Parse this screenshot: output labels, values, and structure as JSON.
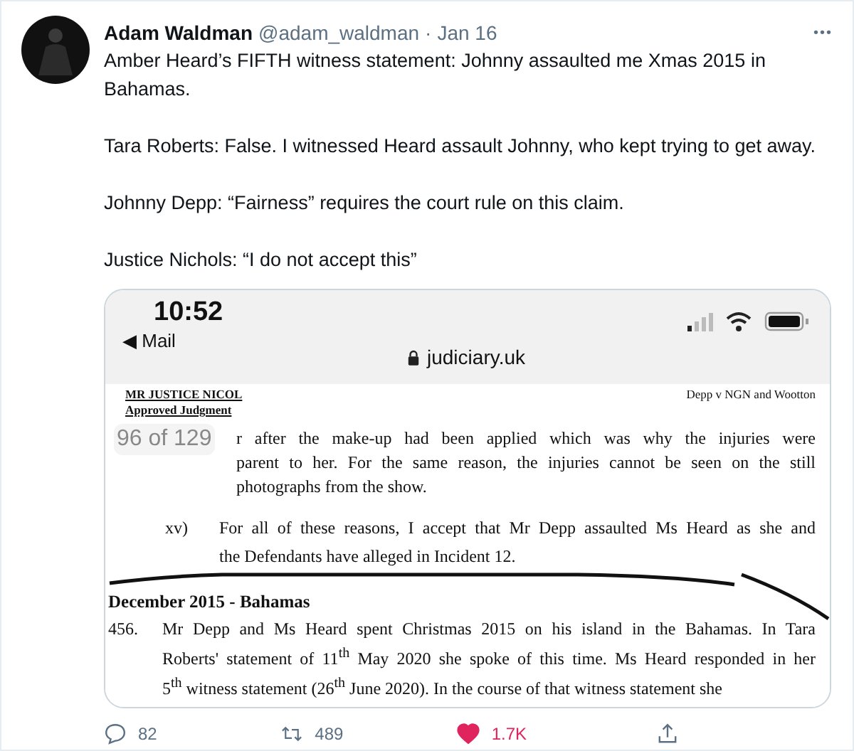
{
  "tweet": {
    "author": {
      "name": "Adam Waldman",
      "handle": "@adam_waldman",
      "separator": "·",
      "date": "Jan 16"
    },
    "paragraphs": [
      "Amber Heard’s FIFTH witness statement: Johnny assaulted me Xmas 2015 in Bahamas.",
      "Tara Roberts: False. I witnessed Heard assault Johnny, who kept trying to get away.",
      "Johnny Depp: “Fairness” requires the court rule on this claim.",
      "Justice Nichols: “I do not accept this”"
    ],
    "more_icon": "•••"
  },
  "screenshot": {
    "status_bar": {
      "time": "10:52",
      "back_label": "◀ Mail",
      "url": "judiciary.uk"
    },
    "document": {
      "header_left": [
        "MR JUSTICE NICOL",
        "Approved Judgment"
      ],
      "header_right": "Depp v NGN and Wootton",
      "page_badge": "96 of 129",
      "blocks": [
        {
          "kind": "continuation",
          "lines": [
            "r after the make-up had been applied which was why the injuries were",
            "parent to her. For the same reason, the injuries cannot be seen on the still",
            "photographs from the show."
          ]
        },
        {
          "kind": "item",
          "number": "xv)",
          "lines": [
            "For all of these reasons, I accept that Mr Depp assaulted Ms Heard as she and",
            "the Defendants have alleged in Incident 12."
          ]
        },
        {
          "kind": "heading",
          "lines": [
            "December 2015 - Bahamas"
          ]
        },
        {
          "kind": "numbered",
          "number": "456.",
          "lines": [
            "Mr Depp and Ms Heard spent Christmas 2015 on his island in the Bahamas. In Tara",
            "Roberts' statement of 11$^{th}$ May 2020 she spoke of this time. Ms Heard responded in her",
            "5$^{th}$ witness statement (26$^{th}$ June 2020). In the course of that witness statement she"
          ]
        }
      ]
    }
  },
  "actions": [
    {
      "kind": "reply",
      "count": "82"
    },
    {
      "kind": "retweet",
      "count": "489"
    },
    {
      "kind": "like",
      "count": "1.7K",
      "liked": true
    },
    {
      "kind": "share"
    }
  ]
}
